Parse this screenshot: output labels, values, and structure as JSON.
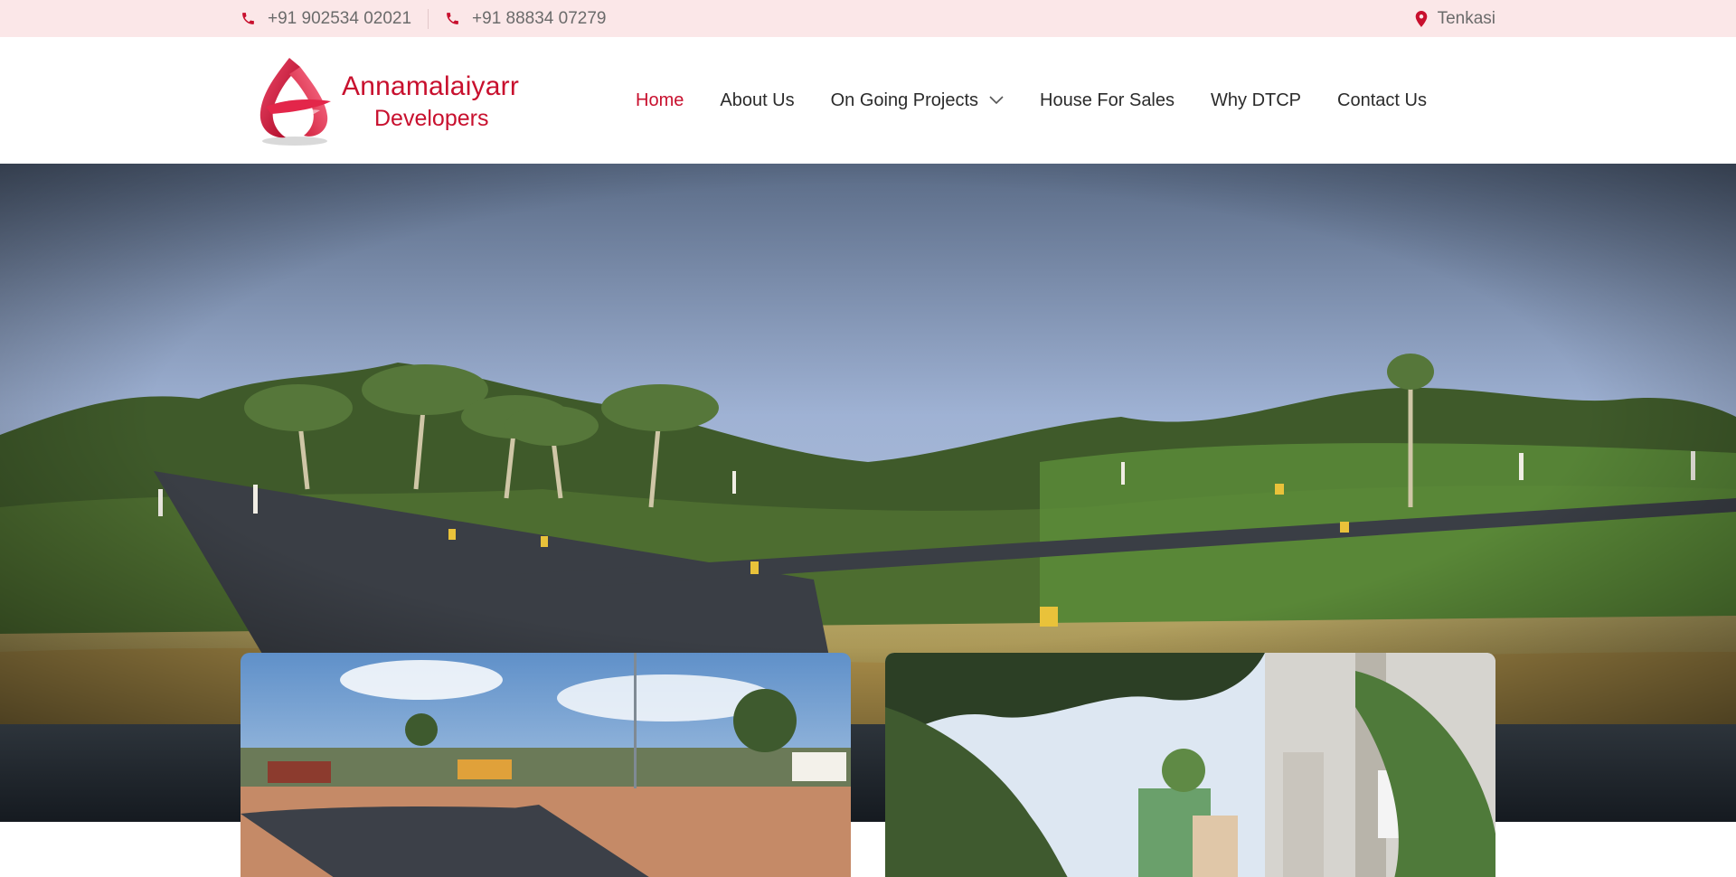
{
  "topbar": {
    "phone1": "+91 902534 02021",
    "phone2": "+91 88834 07279",
    "location": "Tenkasi",
    "icons": [
      "phone-icon",
      "phone-icon",
      "location-pin-icon"
    ]
  },
  "brand": {
    "name_line1": "Annamalaiyarr",
    "name_line2": "Developers"
  },
  "nav": {
    "items": [
      {
        "label": "Home",
        "active": true
      },
      {
        "label": "About Us"
      },
      {
        "label": "On Going Projects",
        "has_dropdown": true
      },
      {
        "label": "House For Sales"
      },
      {
        "label": "Why DTCP"
      },
      {
        "label": "Contact Us"
      }
    ]
  },
  "colors": {
    "brand_red": "#c8102e",
    "topbar_bg": "#fbe7e8",
    "text_dark": "#2b2b2b",
    "text_muted": "#6b6b6b"
  }
}
